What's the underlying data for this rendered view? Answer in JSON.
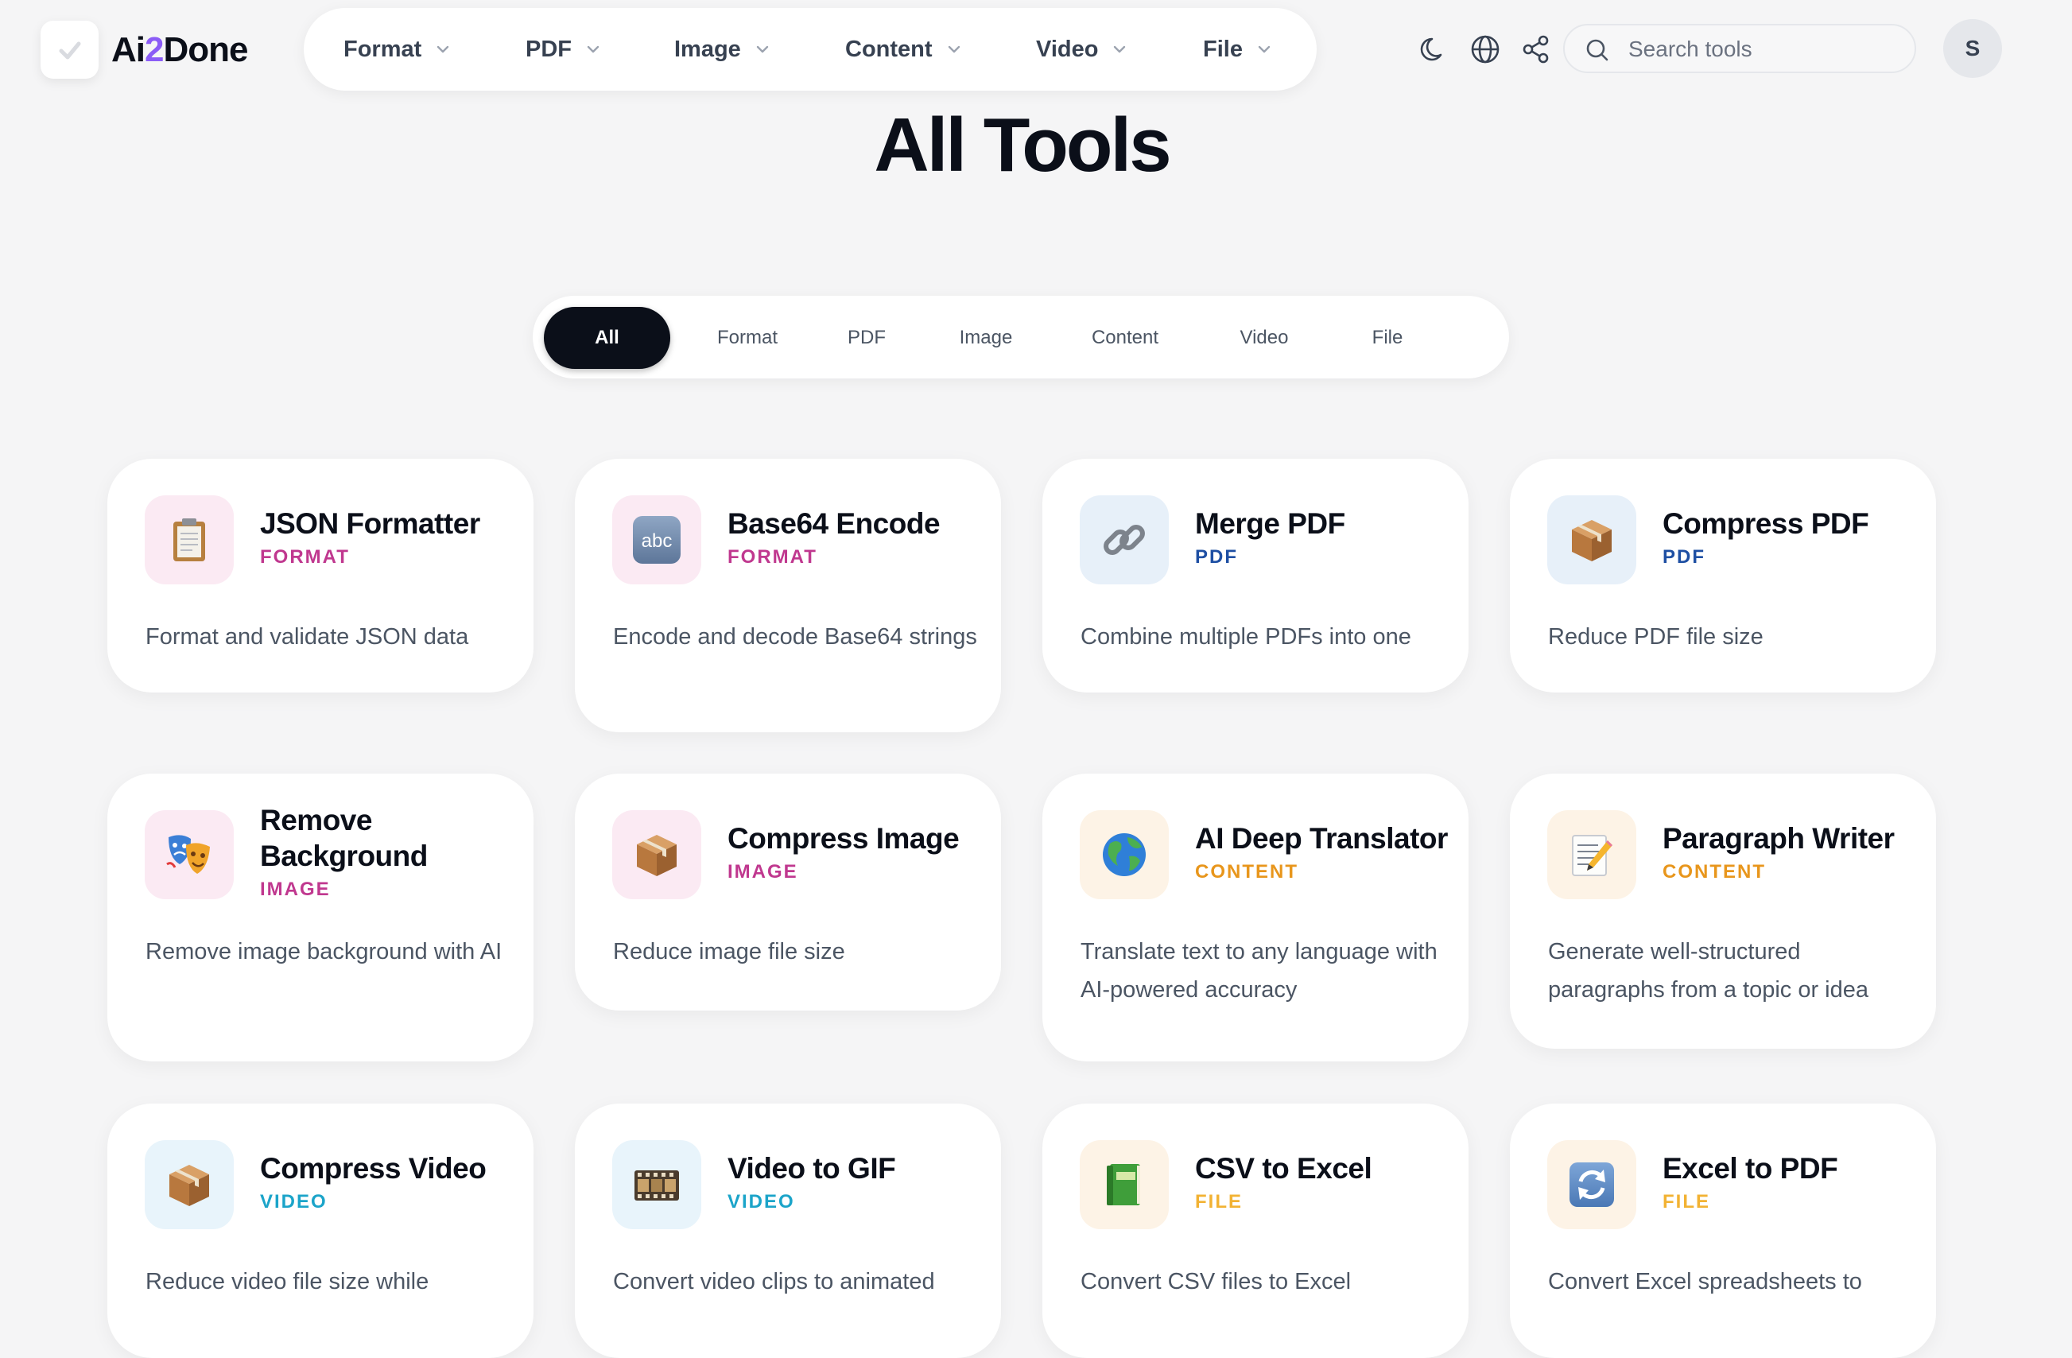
{
  "brand": {
    "logo_pre": "Ai",
    "logo_num": "2",
    "logo_post": "Done",
    "accent_color": "#8b5cf6"
  },
  "topnav": [
    {
      "label": "Format"
    },
    {
      "label": "PDF"
    },
    {
      "label": "Image"
    },
    {
      "label": "Content"
    },
    {
      "label": "Video"
    },
    {
      "label": "File"
    }
  ],
  "header_icons": [
    "moon-icon",
    "globe-icon",
    "share-icon"
  ],
  "search": {
    "placeholder": "Search tools",
    "value": ""
  },
  "user": {
    "initial": "S"
  },
  "page": {
    "title": "All Tools"
  },
  "filter_tabs": [
    {
      "label": "All",
      "active": true
    },
    {
      "label": "Format"
    },
    {
      "label": "PDF"
    },
    {
      "label": "Image"
    },
    {
      "label": "Content"
    },
    {
      "label": "Video"
    },
    {
      "label": "File"
    }
  ],
  "category_colors": {
    "FORMAT": "#c0388f",
    "PDF": "#1e4fa3",
    "IMAGE": "#c0388f",
    "CONTENT": "#e8961c",
    "VIDEO": "#1ba4c9",
    "FILE": "#f2b233"
  },
  "tools": [
    {
      "name": "JSON Formatter",
      "category": "FORMAT",
      "description": "Format and validate JSON data",
      "icon": "clipboard-icon"
    },
    {
      "name": "Base64 Encode",
      "category": "FORMAT",
      "description": "Encode and decode Base64 strings",
      "icon": "abc-icon",
      "icon_text": "abc"
    },
    {
      "name": "Merge PDF",
      "category": "PDF",
      "description": "Combine multiple PDFs into one",
      "icon": "link-icon"
    },
    {
      "name": "Compress PDF",
      "category": "PDF",
      "description": "Reduce PDF file size",
      "icon": "package-icon"
    },
    {
      "name": "Remove Background",
      "category": "IMAGE",
      "description": "Remove image background with AI",
      "icon": "theater-masks-icon"
    },
    {
      "name": "Compress Image",
      "category": "IMAGE",
      "description": "Reduce image file size",
      "icon": "package-icon"
    },
    {
      "name": "AI Deep Translator",
      "category": "CONTENT",
      "description": "Translate text to any language with AI-powered accuracy",
      "icon": "globe-earth-icon"
    },
    {
      "name": "Paragraph Writer",
      "category": "CONTENT",
      "description": "Generate well-structured paragraphs from a topic or idea",
      "icon": "memo-icon"
    },
    {
      "name": "Compress Video",
      "category": "VIDEO",
      "description": "Reduce video file size while",
      "icon": "package-icon"
    },
    {
      "name": "Video to GIF",
      "category": "VIDEO",
      "description": "Convert video clips to animated",
      "icon": "film-icon"
    },
    {
      "name": "CSV to Excel",
      "category": "FILE",
      "description": "Convert CSV files to Excel",
      "icon": "ledger-icon"
    },
    {
      "name": "Excel to PDF",
      "category": "FILE",
      "description": "Convert Excel spreadsheets to",
      "icon": "refresh-icon"
    }
  ]
}
